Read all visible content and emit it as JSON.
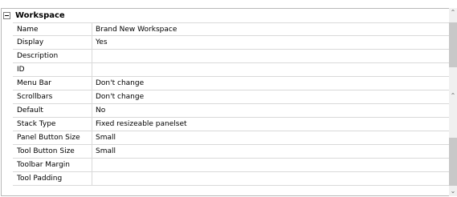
{
  "category": {
    "title": "Workspace",
    "toggle": "collapse"
  },
  "properties": [
    {
      "name": "Name",
      "value": "Brand New Workspace"
    },
    {
      "name": "Display",
      "value": "Yes"
    },
    {
      "name": "Description",
      "value": ""
    },
    {
      "name": "ID",
      "value": ""
    },
    {
      "name": "Menu Bar",
      "value": "Don't change"
    },
    {
      "name": "Scrollbars",
      "value": "Don't change"
    },
    {
      "name": "Default",
      "value": "No"
    },
    {
      "name": "Stack Type",
      "value": "Fixed resizeable panelset"
    },
    {
      "name": "Panel Button Size",
      "value": "Small"
    },
    {
      "name": "Tool Button Size",
      "value": "Small"
    },
    {
      "name": "Toolbar Margin",
      "value": ""
    },
    {
      "name": "Tool Padding",
      "value": ""
    }
  ],
  "scrollbar": {
    "up_icon": "chevron-up-icon",
    "down_icon": "chevron-down-icon"
  }
}
